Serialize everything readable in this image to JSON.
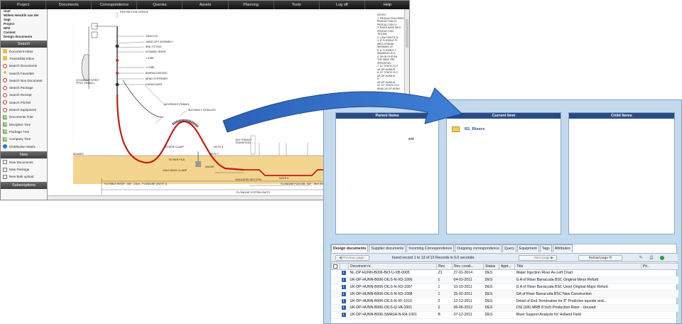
{
  "back_window": {
    "menu": [
      "Project",
      "Documents",
      "Correspondence",
      "Queries",
      "Assets",
      "Planning",
      "Tools",
      "Log off",
      "Help"
    ],
    "user_block": [
      "User",
      "Willem Hendrik van der Sagt",
      "Project",
      "NFD",
      "Context",
      "Design documents"
    ],
    "search_header": "Search",
    "search_items": [
      {
        "label": "Document Inbox",
        "icon": "folder-icon"
      },
      {
        "label": "Transmittal Inbox",
        "icon": "folder-icon"
      },
      {
        "label": "Search Documents",
        "icon": "search-icon"
      },
      {
        "label": "Search Favorites",
        "icon": "star-icon"
      },
      {
        "label": "Search Non Document",
        "icon": "search-icon"
      },
      {
        "label": "Search Package",
        "icon": "search-icon"
      },
      {
        "label": "Search Receipt",
        "icon": "search-icon"
      },
      {
        "label": "Search PO/SO",
        "icon": "search-icon"
      },
      {
        "label": "Search Equipment",
        "icon": "search-icon"
      },
      {
        "label": "Documents Tree",
        "icon": "tree-icon"
      },
      {
        "label": "Discipline Tree",
        "icon": "tree-icon"
      },
      {
        "label": "Package Tree",
        "icon": "tree-icon"
      },
      {
        "label": "Company Tree",
        "icon": "tree-icon"
      },
      {
        "label": "Distribution Matrix",
        "icon": "globe-icon"
      }
    ],
    "new_header": "New",
    "new_items": [
      {
        "label": "New Documents",
        "icon": "document-icon"
      },
      {
        "label": "New Package",
        "icon": "document-icon"
      },
      {
        "label": "New Bulk upload",
        "icon": "document-icon"
      }
    ],
    "footer_header": "Subscriptions",
    "drawing": {
      "labels": {
        "restriction": "RESTRICTION ORIFICE",
        "graylok": "GRAYLOK",
        "handoff": "HANG-OFF ASSEMBLY",
        "bnd": "BND FITTING",
        "dynamic": "DYNAMIC RISER",
        "itube": "I-TUBE",
        "jtube": "J-TUBE",
        "barracuda": "BARRACUDA BSC",
        "bend": "BEND STIFFENER",
        "duraguard": "DURAGUARD",
        "voyageur": "VOYAGEUR SPIRIT FPSO (TBBAH-)",
        "moorings": "MOORINGS (TBBAH)",
        "buoyancy": "BUOYANCY MODULES",
        "tether_clamp": "TETHER CLAMP",
        "tether_pile": "TETHER PILE",
        "hold_back": "HOLD BACK CLAMP",
        "anode": "ANODE",
        "note6": "NOTE 6",
        "note7": "NOTE 7",
        "note5": "NOTE 5",
        "note8": "NOTE 8",
        "note4": "NOTE 4",
        "note3": "NOTE 3",
        "note2": "NOTE 2",
        "seabed": "SEABED",
        "trench": "30m TRENCH TRANSITION",
        "insulated": "30m INSULATED SECTION",
        "insulated2": "INSULATED SECTION",
        "flexible": "FLEXIBLE RISER - 8/6\" - 22km - FLOWLINE (NOTE 1)",
        "flowline": "FLOWLINE FLEX 8/6 - 8/4\" - 8km (NOTE 4)",
        "flowline_limits": "FLOWLINE SYSTEM LIMITS",
        "changes": "CHANGES / SPUR",
        "huntington": "HUNTINGTON PRODUCTION MANIFOLD"
      },
      "notes": "NOTES:\n1. PRODUCTION RISER\nPRODUCTION FL\nPRODUCTION FL\n2. RISER BASE INFO\nPRODUCTION\nTETHER\n3. LOW POINTS IN\n4. 8\" FLEXIBLE FL\nWELLSTREAM\nSKIRMING LE\n5. 6\" FLEXIBLE F\nDRAWING UK-D\n6. SPUR SYSTEM\nTHE SBAS FRE\nZFRKH/HIZL\n7. 12\" STATIC FLO\nUK-DP-HUNN-B\n8. 12\" STATIC FLO\nUK-DP-HUNN-B\n9.\nUK-DP-HUNN-B\n10. 10\" STATIC FLO\nBN(S) UK-DP-HUNN"
    }
  },
  "front_window": {
    "panels": {
      "left_title": "Parent Items",
      "current_title": "Current Item",
      "child_title": "Child Items"
    },
    "left_cut_label": "ent",
    "current_item": {
      "label": "R1_Risers",
      "icon": "folder-icon"
    },
    "tabs": [
      "Design documents",
      "Supplier documents",
      "Incoming Correspondence",
      "Outgoing correspondence",
      "Query",
      "Equipment",
      "Tags",
      "Attributes"
    ],
    "active_tab": 0,
    "pager": {
      "prev": "Previous page",
      "found": "found record 1 to 13 of 13 Records in 0.0 seconds.",
      "next": "Next page",
      "reload": "Reload page"
    },
    "columns": [
      "",
      "",
      "Document nr.",
      "Rev.",
      "Rev. creati...",
      "Status",
      "Appr...",
      "Title",
      "Pri..."
    ],
    "rows": [
      {
        "doc": "NL-DP-HUNN-B006-BIO-U-XB-0005",
        "rev": "Z1",
        "date": "27-01-2014",
        "status": "DES",
        "title": "Water Injection Riser As-Left Chart"
      },
      {
        "doc": "UK-DP-HUNN-B006-OILS-N-XD-1006",
        "rev": "1",
        "date": "04-03-2011",
        "status": "DES",
        "title": "G A of Riser Barracuda BSC Original Minor Refurb"
      },
      {
        "doc": "UK-DP-HUNN-B006-OILS-N-XD-1007",
        "rev": "1",
        "date": "10-10-2011",
        "status": "DES",
        "title": "G A of Riser Barracuda BSC Used Original Major Refurb"
      },
      {
        "doc": "UK-DP-HUNN-B006-OILS-N-XD-1008",
        "rev": "1",
        "date": "25-02-2011",
        "status": "DES",
        "title": "GA of Riser Barracuda BSC New Construction"
      },
      {
        "doc": "UK-DP-HUNN-B006-OILS-N-XF-1010",
        "rev": "2",
        "date": "12-12-2011",
        "status": "DES",
        "title": "Detail of End Termination for 8\" Prodction topside and..."
      },
      {
        "doc": "UK-DP-HUNN-B006-OILS-Q-VA-1001",
        "rev": "2",
        "date": "06-06-2012",
        "status": "DES",
        "title": "OSI (UK) MRB 8 Inch Production Riser - Unused"
      },
      {
        "doc": "UK-DP-HUNN-B006-SMASA-N-RA-1001",
        "rev": "B",
        "date": "07-12-2011",
        "status": "DES",
        "title": "Riser Support Analysis for Holland Field"
      }
    ]
  }
}
